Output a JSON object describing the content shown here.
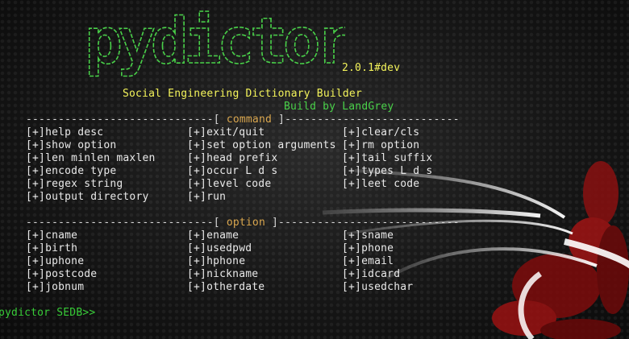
{
  "banner": {
    "logo_text": "pydictor",
    "version": "2.0.1#dev",
    "subtitle": "Social Engineering Dictionary Builder",
    "author": "Build by LandGrey"
  },
  "command_section": {
    "left_dashes": "-----------------------------[ ",
    "title": "command",
    "right_dashes": " ]---------------------------",
    "rows": [
      [
        "[+]help desc",
        "[+]exit/quit",
        "[+]clear/cls"
      ],
      [
        "[+]show option",
        "[+]set option arguments",
        "[+]rm option"
      ],
      [
        "[+]len minlen maxlen",
        "[+]head prefix",
        "[+]tail suffix"
      ],
      [
        "[+]encode type",
        "[+]occur L d s",
        "[+]types L d s"
      ],
      [
        "[+]regex string",
        "[+]level code",
        "[+]leet code"
      ],
      [
        "[+]output directory",
        "[+]run",
        ""
      ]
    ]
  },
  "option_section": {
    "left_dashes": "-----------------------------[ ",
    "title": "option",
    "right_dashes": " ]----------------------------",
    "rows": [
      [
        "[+]cname",
        "[+]ename",
        "[+]sname"
      ],
      [
        "[+]birth",
        "[+]usedpwd",
        "[+]phone"
      ],
      [
        "[+]uphone",
        "[+]hphone",
        "[+]email"
      ],
      [
        "[+]postcode",
        "[+]nickname",
        "[+]idcard"
      ],
      [
        "[+]jobnum",
        "[+]otherdate",
        "[+]usedchar"
      ]
    ]
  },
  "prompt": "pydictor SEDB>>",
  "colors": {
    "logo_green": "#49d049",
    "version_yellow": "#f3f35a",
    "section_title_orange": "#d9a64e",
    "prompt_green": "#38cc38"
  }
}
